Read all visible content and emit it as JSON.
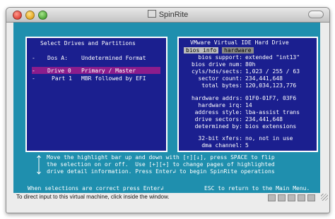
{
  "window": {
    "title": "SpinRite"
  },
  "left_panel": {
    "title": "Select Drives and Partitions",
    "rows": [
      {
        "marker": "-",
        "label": "Dos A:",
        "detail": "Undetermined Format"
      },
      {
        "marker": "-",
        "label": "Drive 0",
        "detail": "Primary / Master"
      },
      {
        "marker": "-",
        "label": "Part 1",
        "detail": "MBR followed by EFI"
      }
    ]
  },
  "right_panel": {
    "title": "VMware Virtual IDE Hard Drive",
    "tabs": [
      "bios info",
      "hardware"
    ],
    "bios_fields": [
      {
        "label": "bios support:",
        "value": "extended \"int13\""
      },
      {
        "label": "bios drive num:",
        "value": "80h"
      },
      {
        "label": "cyls/hds/sects:",
        "value": "1,023 / 255 / 63"
      },
      {
        "label": "sector count:",
        "value": "234,441,648"
      },
      {
        "label": "total bytes:",
        "value": "120,034,123,776"
      }
    ],
    "hw_fields": [
      {
        "label": "hardware addrs:",
        "value": "01F0-01F7, 03F6"
      },
      {
        "label": "hardware irq:",
        "value": "14"
      },
      {
        "label": "address style:",
        "value": "lba-assist trans"
      },
      {
        "label": "drive sectors:",
        "value": "234,441,648"
      },
      {
        "label": "determined by:",
        "value": "bios extensions"
      }
    ],
    "xfer_fields": [
      {
        "label": "32-bit xfers:",
        "value": "no, not in use"
      },
      {
        "label": "dma channel:",
        "value": "5"
      }
    ]
  },
  "instructions": {
    "lines": [
      "Move the highlight bar up and down with [↑][↓], press SPACE to flip",
      "the selection on or off.  Use [+][+] to change pages of highlighted",
      "drive detail information. Press Enter↲ to begin SpinRite operations"
    ],
    "footer_left": "When selections are correct press Enter↲",
    "footer_right": "ESC to return to the Main Menu."
  },
  "statusbar": {
    "text": "To direct input to this virtual machine, click inside the window."
  }
}
